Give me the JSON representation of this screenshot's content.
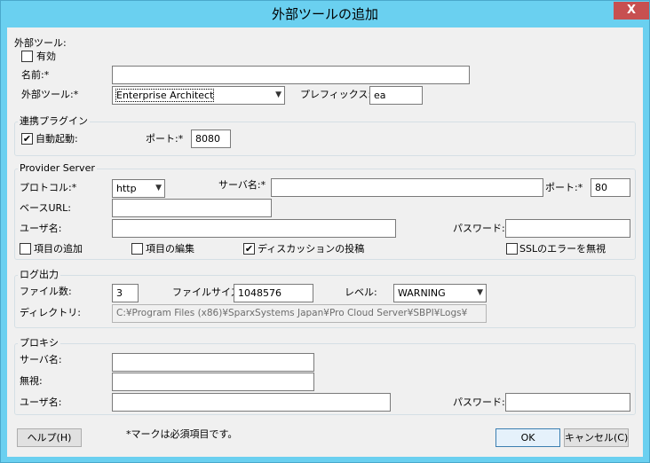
{
  "window": {
    "title": "外部ツールの追加",
    "close_glyph": "X"
  },
  "external_tool": {
    "section_label": "外部ツール:",
    "enabled_label": "有効",
    "enabled_checked": false,
    "name_label": "名前:*",
    "name_value": "",
    "tool_label": "外部ツール:*",
    "tool_value": "Enterprise Architect",
    "prefix_label": "プレフィックス:*",
    "prefix_value": "ea"
  },
  "plugin": {
    "group_label": "連携プラグイン",
    "autostart_label": "自動起動:",
    "autostart_checked": true,
    "port_label": "ポート:*",
    "port_value": "8080"
  },
  "provider": {
    "group_label": "Provider Server",
    "protocol_label": "プロトコル:*",
    "protocol_value": "http",
    "server_label": "サーバ名:*",
    "server_value": "",
    "port_label": "ポート:*",
    "port_value": "80",
    "baseurl_label": "ベースURL:",
    "baseurl_value": "",
    "user_label": "ユーザ名:",
    "user_value": "",
    "password_label": "パスワード:",
    "password_value": "",
    "add_items_label": "項目の追加",
    "add_items_checked": false,
    "edit_items_label": "項目の編集",
    "edit_items_checked": false,
    "post_discussion_label": "ディスカッションの投稿",
    "post_discussion_checked": true,
    "ignore_ssl_label": "SSLのエラーを無視",
    "ignore_ssl_checked": false
  },
  "log": {
    "group_label": "ログ出力",
    "file_count_label": "ファイル数:",
    "file_count_value": "3",
    "file_size_label": "ファイルサイズ:",
    "file_size_value": "1048576",
    "level_label": "レベル:",
    "level_value": "WARNING",
    "directory_label": "ディレクトリ:",
    "directory_value": "C:¥Program Files (x86)¥SparxSystems Japan¥Pro Cloud Server¥SBPI¥Logs¥"
  },
  "proxy": {
    "group_label": "プロキシ",
    "server_label": "サーバ名:",
    "server_value": "",
    "ignore_label": "無視:",
    "ignore_value": "",
    "user_label": "ユーザ名:",
    "user_value": "",
    "password_label": "パスワード:",
    "password_value": ""
  },
  "footer": {
    "help_label": "ヘルプ(H)",
    "required_note": "*マークは必須項目です。",
    "ok_label": "OK",
    "cancel_label": "キャンセル(C)"
  },
  "icons": {
    "checked_glyph": "✔",
    "dropdown_glyph": "▼"
  }
}
